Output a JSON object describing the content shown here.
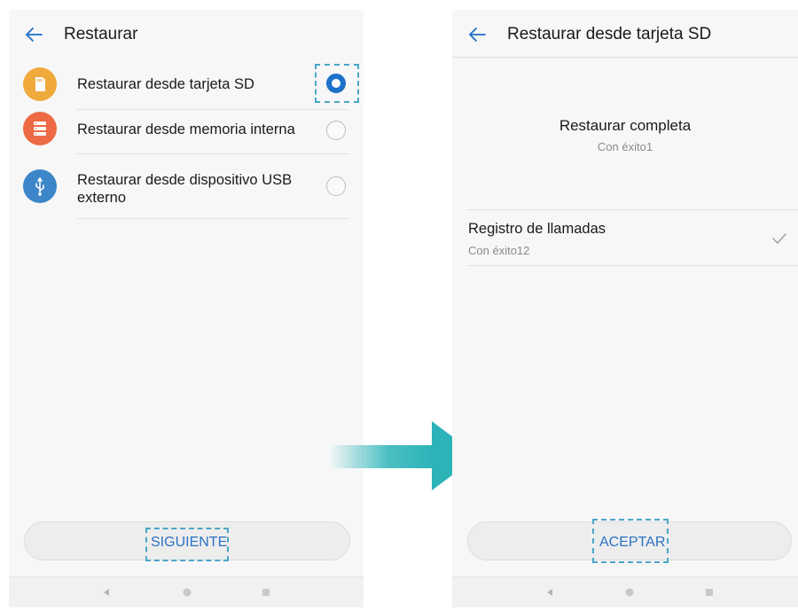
{
  "left_screen": {
    "title": "Restaurar",
    "options": [
      {
        "label": "Restaurar desde tarjeta SD",
        "icon": "sd-card-icon",
        "color": "#f0a93b",
        "selected": true
      },
      {
        "label": "Restaurar desde memoria interna",
        "icon": "internal-storage-icon",
        "color": "#ee6a44",
        "selected": false
      },
      {
        "label": "Restaurar desde dispositivo USB externo",
        "icon": "usb-icon",
        "color": "#3c86c9",
        "selected": false
      }
    ],
    "next_button": "SIGUIENTE"
  },
  "right_screen": {
    "title": "Restaurar desde tarjeta SD",
    "status_title": "Restaurar completa",
    "status_sub": "Con éxito1",
    "records": [
      {
        "title": "Registro de llamadas",
        "sub": "Con éxito12",
        "done": true
      }
    ],
    "accept_button": "ACEPTAR"
  },
  "nav_bar": {
    "icons": [
      "back-triangle-icon",
      "home-circle-icon",
      "recents-square-icon"
    ]
  },
  "colors": {
    "accent": "#1e70c8",
    "highlight": "#4aa6c8",
    "arrow": "#2bb3b8"
  }
}
